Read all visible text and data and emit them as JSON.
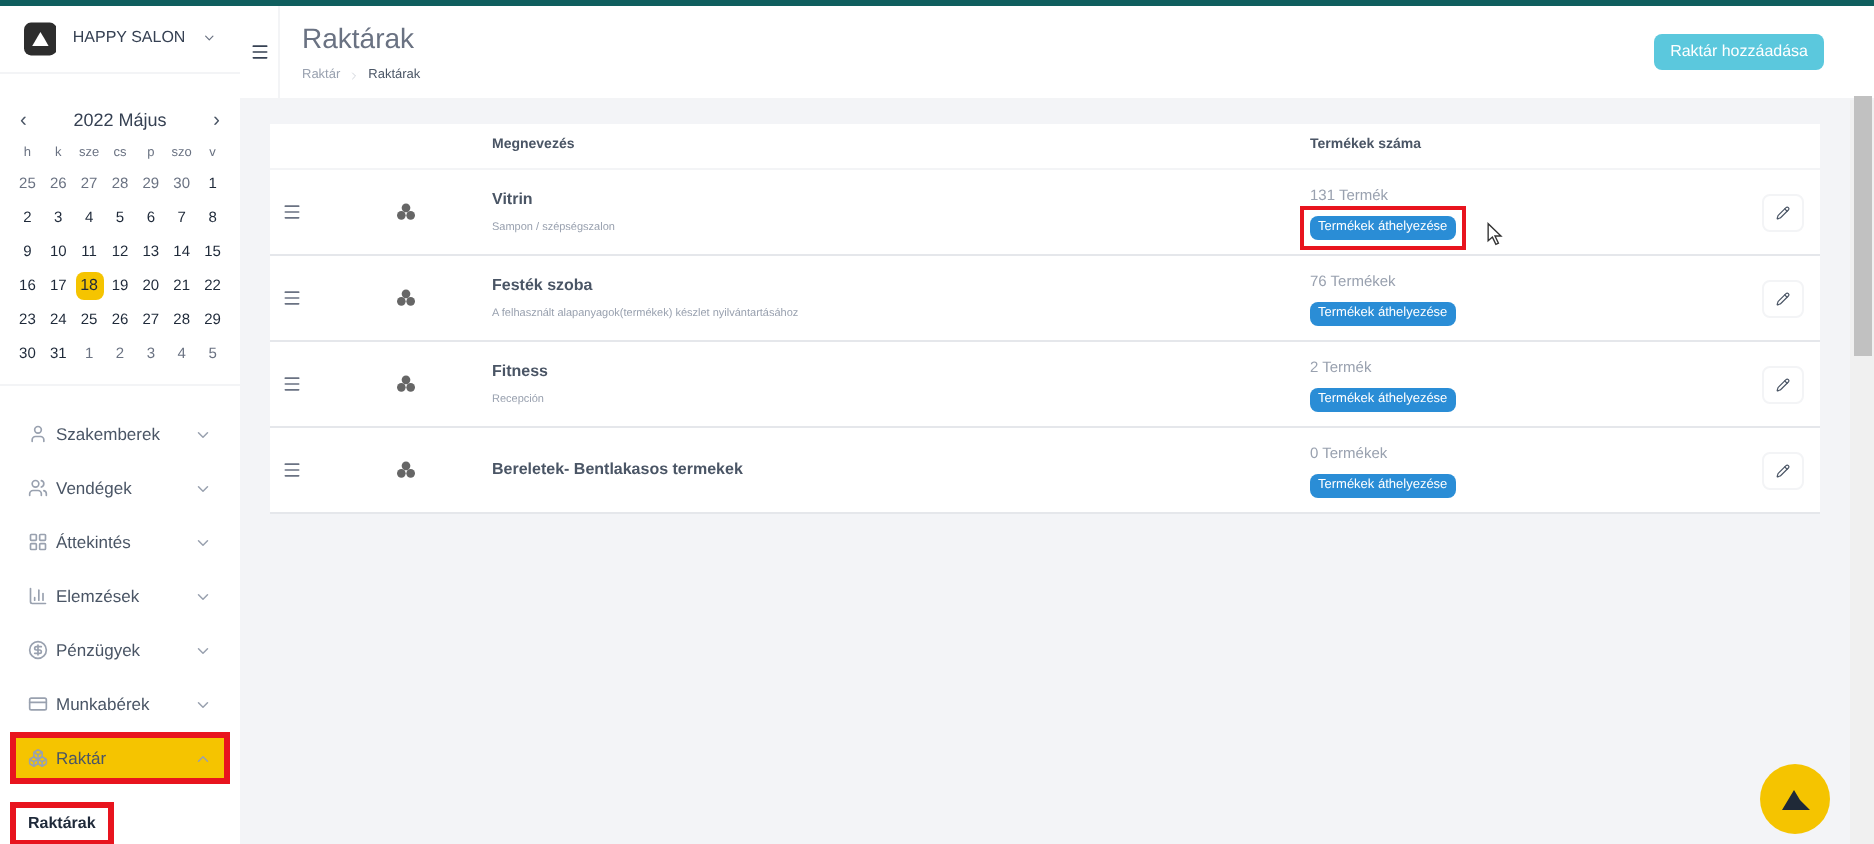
{
  "brand": {
    "name": "HAPPY SALON"
  },
  "calendar": {
    "prev": "‹",
    "title": "2022 Május",
    "next": "›",
    "weekdays": [
      "h",
      "k",
      "sze",
      "cs",
      "p",
      "szo",
      "v"
    ],
    "weeks": [
      [
        {
          "d": "25",
          "muted": true,
          "selected": false
        },
        {
          "d": "26",
          "muted": true,
          "selected": false
        },
        {
          "d": "27",
          "muted": true,
          "selected": false
        },
        {
          "d": "28",
          "muted": true,
          "selected": false
        },
        {
          "d": "29",
          "muted": true,
          "selected": false
        },
        {
          "d": "30",
          "muted": true,
          "selected": false
        },
        {
          "d": "1",
          "muted": false,
          "selected": false
        }
      ],
      [
        {
          "d": "2",
          "muted": false,
          "selected": false
        },
        {
          "d": "3",
          "muted": false,
          "selected": false
        },
        {
          "d": "4",
          "muted": false,
          "selected": false
        },
        {
          "d": "5",
          "muted": false,
          "selected": false
        },
        {
          "d": "6",
          "muted": false,
          "selected": false
        },
        {
          "d": "7",
          "muted": false,
          "selected": false
        },
        {
          "d": "8",
          "muted": false,
          "selected": false
        }
      ],
      [
        {
          "d": "9",
          "muted": false,
          "selected": false
        },
        {
          "d": "10",
          "muted": false,
          "selected": false
        },
        {
          "d": "11",
          "muted": false,
          "selected": false
        },
        {
          "d": "12",
          "muted": false,
          "selected": false
        },
        {
          "d": "13",
          "muted": false,
          "selected": false
        },
        {
          "d": "14",
          "muted": false,
          "selected": false
        },
        {
          "d": "15",
          "muted": false,
          "selected": false
        }
      ],
      [
        {
          "d": "16",
          "muted": false,
          "selected": false
        },
        {
          "d": "17",
          "muted": false,
          "selected": false
        },
        {
          "d": "18",
          "muted": false,
          "selected": true
        },
        {
          "d": "19",
          "muted": false,
          "selected": false
        },
        {
          "d": "20",
          "muted": false,
          "selected": false
        },
        {
          "d": "21",
          "muted": false,
          "selected": false
        },
        {
          "d": "22",
          "muted": false,
          "selected": false
        }
      ],
      [
        {
          "d": "23",
          "muted": false,
          "selected": false
        },
        {
          "d": "24",
          "muted": false,
          "selected": false
        },
        {
          "d": "25",
          "muted": false,
          "selected": false
        },
        {
          "d": "26",
          "muted": false,
          "selected": false
        },
        {
          "d": "27",
          "muted": false,
          "selected": false
        },
        {
          "d": "28",
          "muted": false,
          "selected": false
        },
        {
          "d": "29",
          "muted": false,
          "selected": false
        }
      ],
      [
        {
          "d": "30",
          "muted": false,
          "selected": false
        },
        {
          "d": "31",
          "muted": false,
          "selected": false
        },
        {
          "d": "1",
          "muted": true,
          "selected": false
        },
        {
          "d": "2",
          "muted": true,
          "selected": false
        },
        {
          "d": "3",
          "muted": true,
          "selected": false
        },
        {
          "d": "4",
          "muted": true,
          "selected": false
        },
        {
          "d": "5",
          "muted": true,
          "selected": false
        }
      ]
    ]
  },
  "sidebar": {
    "items": [
      {
        "kind": "person",
        "label": "Szakemberek",
        "expanded": false,
        "selected": false,
        "highlighted": false
      },
      {
        "kind": "group",
        "label": "Vendégek",
        "expanded": false,
        "selected": false,
        "highlighted": false
      },
      {
        "kind": "grid",
        "label": "Áttekintés",
        "expanded": false,
        "selected": false,
        "highlighted": false
      },
      {
        "kind": "chart",
        "label": "Elemzések",
        "expanded": false,
        "selected": false,
        "highlighted": false
      },
      {
        "kind": "coin",
        "label": "Pénzügyek",
        "expanded": false,
        "selected": false,
        "highlighted": false
      },
      {
        "kind": "card",
        "label": "Munkabérek",
        "expanded": false,
        "selected": false,
        "highlighted": false
      },
      {
        "kind": "boxes",
        "label": "Raktár",
        "expanded": true,
        "selected": true,
        "highlighted": true,
        "children": [
          {
            "label": "Raktárak",
            "selected": true,
            "highlighted": true
          }
        ]
      }
    ]
  },
  "header": {
    "title": "Raktárak",
    "breadcrumb": [
      "Raktár",
      "Raktárak"
    ],
    "button": "Raktár hozzáadása"
  },
  "table": {
    "columns": [
      "Megnevezés",
      "Termékek száma"
    ],
    "rows": [
      {
        "name": "Vitrin",
        "description": "Sampon / szépségszalon",
        "count": "131 Termék",
        "action": "Termékek áthelyezése",
        "highlighted": true
      },
      {
        "name": "Festék szoba",
        "description": "A felhasznált alapanyagok(termékek) készlet nyilvántartásához",
        "count": "76 Termékek",
        "action": "Termékek áthelyezése",
        "highlighted": false
      },
      {
        "name": "Fitness",
        "description": "Recepción",
        "count": "2 Termék",
        "action": "Termékek áthelyezése",
        "highlighted": false
      },
      {
        "name": "Bereletek- Bentlakasos termekek",
        "count": "0 Termékek",
        "action": "Termékek áthelyezése",
        "highlighted": false
      }
    ]
  }
}
